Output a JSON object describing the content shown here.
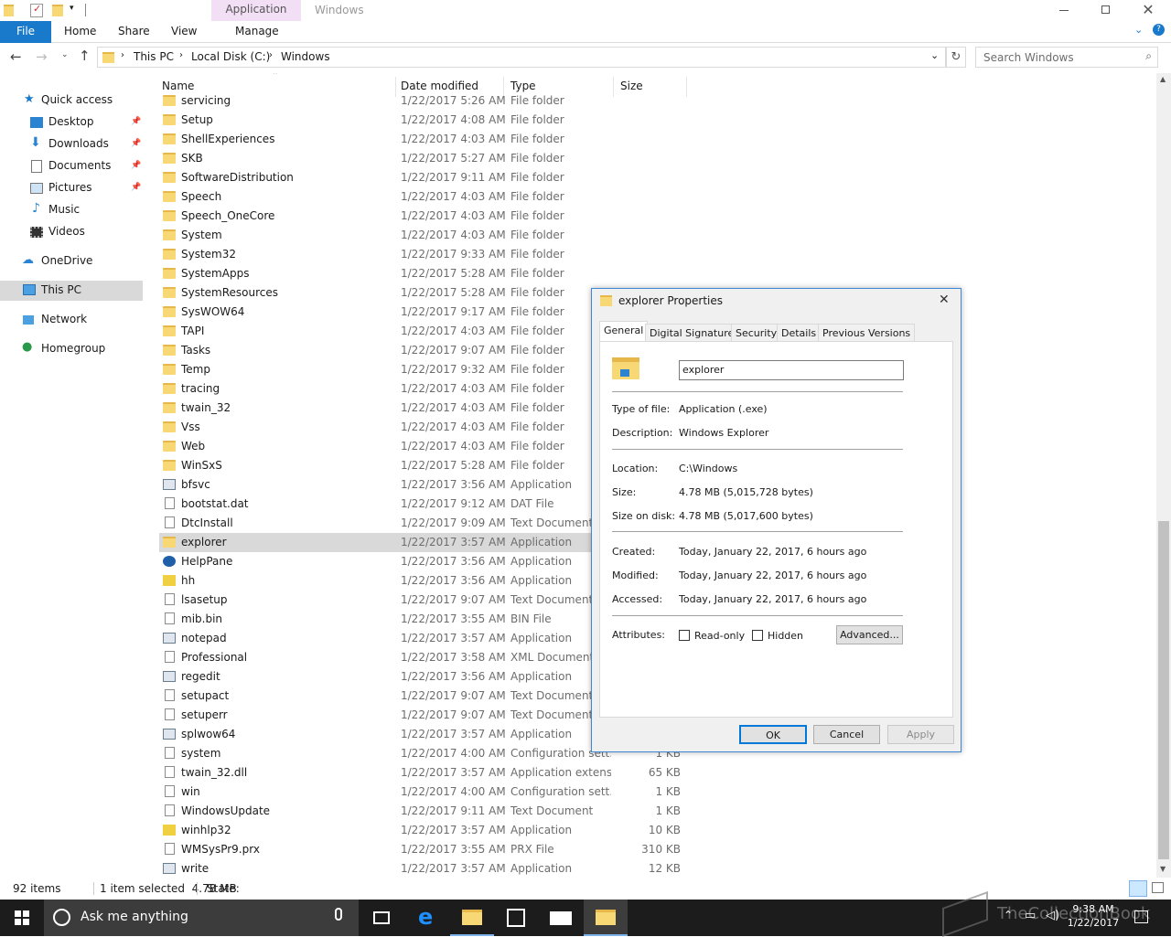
{
  "window": {
    "title": "Windows",
    "context_tab": "Application Tools"
  },
  "ribbon": {
    "tabs": [
      "File",
      "Home",
      "Share",
      "View",
      "Manage"
    ]
  },
  "address": {
    "crumbs": [
      "This PC",
      "Local Disk (C:)",
      "Windows"
    ],
    "search_placeholder": "Search Windows"
  },
  "columns": {
    "name": "Name",
    "date": "Date modified",
    "type": "Type",
    "size": "Size"
  },
  "nav": [
    {
      "label": "Quick access",
      "icon": "star-icon"
    },
    {
      "label": "Desktop",
      "icon": "desktop-icon",
      "pinned": true
    },
    {
      "label": "Downloads",
      "icon": "download-icon",
      "pinned": true
    },
    {
      "label": "Documents",
      "icon": "documents-icon",
      "pinned": true
    },
    {
      "label": "Pictures",
      "icon": "pictures-icon",
      "pinned": true
    },
    {
      "label": "Music",
      "icon": "music-icon"
    },
    {
      "label": "Videos",
      "icon": "videos-icon"
    },
    {
      "label": "OneDrive",
      "icon": "cloud-icon"
    },
    {
      "label": "This PC",
      "icon": "computer-icon"
    },
    {
      "label": "Network",
      "icon": "network-icon"
    },
    {
      "label": "Homegroup",
      "icon": "homegroup-icon"
    }
  ],
  "files": [
    {
      "name": "servicing",
      "date": "1/22/2017 5:26 AM",
      "type": "File folder",
      "size": "",
      "kind": "folder"
    },
    {
      "name": "Setup",
      "date": "1/22/2017 4:08 AM",
      "type": "File folder",
      "size": "",
      "kind": "folder"
    },
    {
      "name": "ShellExperiences",
      "date": "1/22/2017 4:03 AM",
      "type": "File folder",
      "size": "",
      "kind": "folder"
    },
    {
      "name": "SKB",
      "date": "1/22/2017 5:27 AM",
      "type": "File folder",
      "size": "",
      "kind": "folder"
    },
    {
      "name": "SoftwareDistribution",
      "date": "1/22/2017 9:11 AM",
      "type": "File folder",
      "size": "",
      "kind": "folder"
    },
    {
      "name": "Speech",
      "date": "1/22/2017 4:03 AM",
      "type": "File folder",
      "size": "",
      "kind": "folder"
    },
    {
      "name": "Speech_OneCore",
      "date": "1/22/2017 4:03 AM",
      "type": "File folder",
      "size": "",
      "kind": "folder"
    },
    {
      "name": "System",
      "date": "1/22/2017 4:03 AM",
      "type": "File folder",
      "size": "",
      "kind": "folder"
    },
    {
      "name": "System32",
      "date": "1/22/2017 9:33 AM",
      "type": "File folder",
      "size": "",
      "kind": "folder"
    },
    {
      "name": "SystemApps",
      "date": "1/22/2017 5:28 AM",
      "type": "File folder",
      "size": "",
      "kind": "folder"
    },
    {
      "name": "SystemResources",
      "date": "1/22/2017 5:28 AM",
      "type": "File folder",
      "size": "",
      "kind": "folder"
    },
    {
      "name": "SysWOW64",
      "date": "1/22/2017 9:17 AM",
      "type": "File folder",
      "size": "",
      "kind": "folder"
    },
    {
      "name": "TAPI",
      "date": "1/22/2017 4:03 AM",
      "type": "File folder",
      "size": "",
      "kind": "folder"
    },
    {
      "name": "Tasks",
      "date": "1/22/2017 9:07 AM",
      "type": "File folder",
      "size": "",
      "kind": "folder"
    },
    {
      "name": "Temp",
      "date": "1/22/2017 9:32 AM",
      "type": "File folder",
      "size": "",
      "kind": "folder"
    },
    {
      "name": "tracing",
      "date": "1/22/2017 4:03 AM",
      "type": "File folder",
      "size": "",
      "kind": "folder"
    },
    {
      "name": "twain_32",
      "date": "1/22/2017 4:03 AM",
      "type": "File folder",
      "size": "",
      "kind": "folder"
    },
    {
      "name": "Vss",
      "date": "1/22/2017 4:03 AM",
      "type": "File folder",
      "size": "",
      "kind": "folder"
    },
    {
      "name": "Web",
      "date": "1/22/2017 4:03 AM",
      "type": "File folder",
      "size": "",
      "kind": "folder"
    },
    {
      "name": "WinSxS",
      "date": "1/22/2017 5:28 AM",
      "type": "File folder",
      "size": "",
      "kind": "folder"
    },
    {
      "name": "bfsvc",
      "date": "1/22/2017 3:56 AM",
      "type": "Application",
      "size": "",
      "kind": "app"
    },
    {
      "name": "bootstat.dat",
      "date": "1/22/2017 9:12 AM",
      "type": "DAT File",
      "size": "",
      "kind": "file"
    },
    {
      "name": "DtcInstall",
      "date": "1/22/2017 9:09 AM",
      "type": "Text Document",
      "size": "",
      "kind": "file"
    },
    {
      "name": "explorer",
      "date": "1/22/2017 3:57 AM",
      "type": "Application",
      "size": "",
      "kind": "folder",
      "selected": true
    },
    {
      "name": "HelpPane",
      "date": "1/22/2017 3:56 AM",
      "type": "Application",
      "size": "",
      "kind": "help"
    },
    {
      "name": "hh",
      "date": "1/22/2017 3:56 AM",
      "type": "Application",
      "size": "",
      "kind": "help2"
    },
    {
      "name": "lsasetup",
      "date": "1/22/2017 9:07 AM",
      "type": "Text Document",
      "size": "",
      "kind": "file"
    },
    {
      "name": "mib.bin",
      "date": "1/22/2017 3:55 AM",
      "type": "BIN File",
      "size": "",
      "kind": "file"
    },
    {
      "name": "notepad",
      "date": "1/22/2017 3:57 AM",
      "type": "Application",
      "size": "",
      "kind": "app"
    },
    {
      "name": "Professional",
      "date": "1/22/2017 3:58 AM",
      "type": "XML Document",
      "size": "",
      "kind": "file"
    },
    {
      "name": "regedit",
      "date": "1/22/2017 3:56 AM",
      "type": "Application",
      "size": "",
      "kind": "app"
    },
    {
      "name": "setupact",
      "date": "1/22/2017 9:07 AM",
      "type": "Text Document",
      "size": "",
      "kind": "file"
    },
    {
      "name": "setuperr",
      "date": "1/22/2017 9:07 AM",
      "type": "Text Document",
      "size": "",
      "kind": "file"
    },
    {
      "name": "splwow64",
      "date": "1/22/2017 3:57 AM",
      "type": "Application",
      "size": "",
      "kind": "app"
    },
    {
      "name": "system",
      "date": "1/22/2017 4:00 AM",
      "type": "Configuration sett...",
      "size": "1 KB",
      "kind": "file"
    },
    {
      "name": "twain_32.dll",
      "date": "1/22/2017 3:57 AM",
      "type": "Application extens...",
      "size": "65 KB",
      "kind": "file"
    },
    {
      "name": "win",
      "date": "1/22/2017 4:00 AM",
      "type": "Configuration sett...",
      "size": "1 KB",
      "kind": "file"
    },
    {
      "name": "WindowsUpdate",
      "date": "1/22/2017 9:11 AM",
      "type": "Text Document",
      "size": "1 KB",
      "kind": "file"
    },
    {
      "name": "winhlp32",
      "date": "1/22/2017 3:57 AM",
      "type": "Application",
      "size": "10 KB",
      "kind": "help2"
    },
    {
      "name": "WMSysPr9.prx",
      "date": "1/22/2017 3:55 AM",
      "type": "PRX File",
      "size": "310 KB",
      "kind": "file"
    },
    {
      "name": "write",
      "date": "1/22/2017 3:57 AM",
      "type": "Application",
      "size": "12 KB",
      "kind": "app"
    }
  ],
  "status": {
    "count": "92 items",
    "selected": "1 item selected  4.78 MB",
    "state": "State:"
  },
  "dialog": {
    "title": "explorer Properties",
    "tabs": [
      "General",
      "Digital Signatures",
      "Security",
      "Details",
      "Previous Versions"
    ],
    "name_value": "explorer",
    "type_label": "Type of file:",
    "type_value": "Application (.exe)",
    "desc_label": "Description:",
    "desc_value": "Windows Explorer",
    "loc_label": "Location:",
    "loc_value": "C:\\Windows",
    "size_label": "Size:",
    "size_value": "4.78 MB (5,015,728 bytes)",
    "disk_label": "Size on disk:",
    "disk_value": "4.78 MB (5,017,600 bytes)",
    "created_label": "Created:",
    "created_value": "Today, January 22, 2017, 6 hours ago",
    "modified_label": "Modified:",
    "modified_value": "Today, January 22, 2017, 6 hours ago",
    "accessed_label": "Accessed:",
    "accessed_value": "Today, January 22, 2017, 6 hours ago",
    "attr_label": "Attributes:",
    "readonly_label": "Read-only",
    "hidden_label": "Hidden",
    "advanced_label": "Advanced...",
    "ok_label": "OK",
    "cancel_label": "Cancel",
    "apply_label": "Apply"
  },
  "taskbar": {
    "search_placeholder": "Ask me anything",
    "time": "9:38 AM",
    "date": "1/22/2017",
    "watermark": "TheCollectionBook"
  },
  "colors": {
    "accent": "#1979ca",
    "selected_row": "#d9d9d9",
    "context_tab": "#f2dff5",
    "taskbar": "#1c1c1c"
  }
}
